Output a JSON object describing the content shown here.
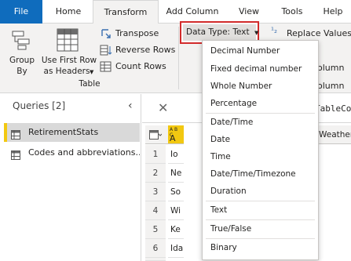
{
  "tabs": [
    {
      "label": "File"
    },
    {
      "label": "Home"
    },
    {
      "label": "Transform"
    },
    {
      "label": "Add Column"
    },
    {
      "label": "View"
    },
    {
      "label": "Tools"
    },
    {
      "label": "Help"
    }
  ],
  "ribbon": {
    "group_by": [
      "Group",
      "By"
    ],
    "use_first_row": [
      "Use First Row",
      "as Headers"
    ],
    "group_table_label": "Table",
    "transpose": "Transpose",
    "reverse_rows": "Reverse Rows",
    "count_rows": "Count Rows",
    "data_type_button": "Data Type: Text",
    "replace_values": "Replace Values",
    "partial_right_1": "olumn",
    "partial_right_2": "olumn"
  },
  "queries": {
    "title": "Queries [2]",
    "items": [
      {
        "label": "RetirementStats",
        "selected": true
      },
      {
        "label": "Codes and abbreviations...",
        "selected": false
      }
    ]
  },
  "formula_partial": "TableCo",
  "grid": {
    "col_header_partial": "A",
    "col_header_type": "A B C",
    "weather_header": "Weather",
    "rows": [
      {
        "num": "1",
        "value": "Io"
      },
      {
        "num": "2",
        "value": "Ne"
      },
      {
        "num": "3",
        "value": "So"
      },
      {
        "num": "4",
        "value": "Wi"
      },
      {
        "num": "5",
        "value": "Ke"
      },
      {
        "num": "6",
        "value": "Ida"
      },
      {
        "num": "7",
        "value": "Ne"
      }
    ]
  },
  "data_type_menu": {
    "items": [
      "Decimal Number",
      "Fixed decimal number",
      "Whole Number",
      "Percentage",
      "Date/Time",
      "Date",
      "Time",
      "Date/Time/Timezone",
      "Duration",
      "Text",
      "True/False",
      "Binary"
    ]
  },
  "colors": {
    "file_tab": "#0f6cbd",
    "highlight_border": "#d22b2b",
    "selected_query_bar": "#f2c811"
  }
}
